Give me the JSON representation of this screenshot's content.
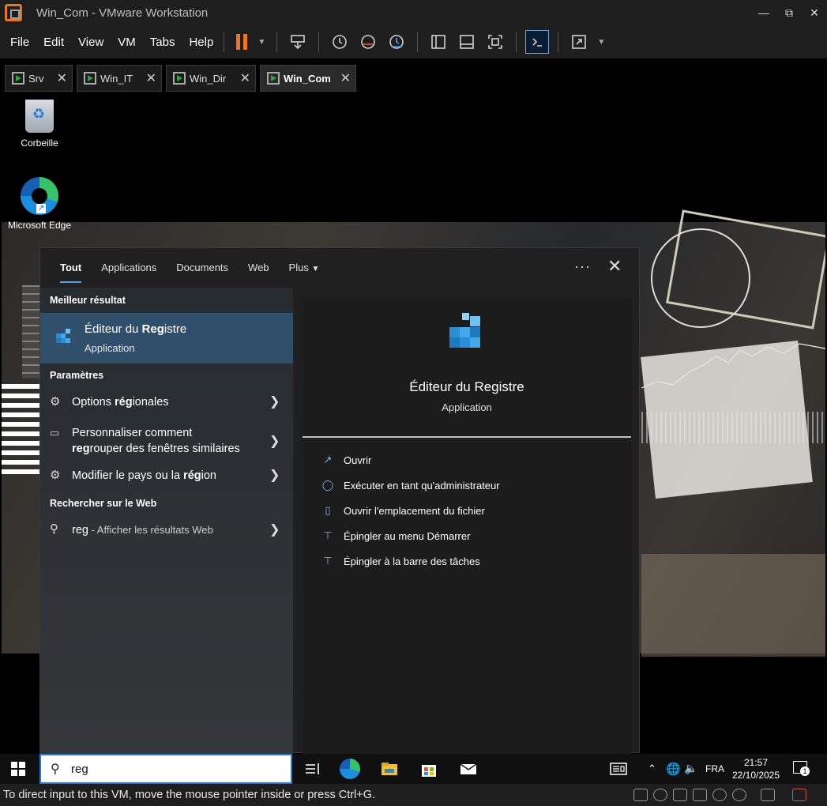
{
  "window": {
    "title": "Win_Com - VMware Workstation",
    "controls": [
      "minimize-icon",
      "restore-icon",
      "close-icon"
    ]
  },
  "menu": [
    "File",
    "Edit",
    "View",
    "VM",
    "Tabs",
    "Help"
  ],
  "tabs": [
    {
      "label": "Srv",
      "active": false
    },
    {
      "label": "Win_IT",
      "active": false
    },
    {
      "label": "Win_Dir",
      "active": false
    },
    {
      "label": "Win_Com",
      "active": true
    }
  ],
  "desktop": {
    "icons": [
      {
        "label": "Corbeille",
        "icon": "recycle-bin-icon"
      },
      {
        "label": "Microsoft Edge",
        "icon": "edge-icon"
      }
    ]
  },
  "search_panel": {
    "filters": [
      "Tout",
      "Applications",
      "Documents",
      "Web",
      "Plus"
    ],
    "active_filter": "Tout",
    "best_section": "Meilleur résultat",
    "best": {
      "name_pre": "Éditeur du ",
      "name_bold": "Reg",
      "name_post": "istre",
      "type": "Application"
    },
    "settings_section": "Paramètres",
    "settings": [
      {
        "pre": "Options ",
        "bold": "rég",
        "post": "ionales",
        "icon": "globe-settings-icon"
      },
      {
        "line1": "Personnaliser comment",
        "bold": "reg",
        "post": "rouper des fenêtres similaires",
        "icon": "taskbar-settings-icon"
      },
      {
        "pre": "Modifier le pays ou la ",
        "bold": "rég",
        "post": "ion",
        "icon": "globe-settings-icon"
      }
    ],
    "web_section": "Rechercher sur le Web",
    "web": {
      "query": "reg",
      "suffix": " - Afficher les résultats Web"
    },
    "detail": {
      "title": "Éditeur du Registre",
      "type": "Application",
      "actions": [
        {
          "label": "Ouvrir",
          "icon": "open-icon"
        },
        {
          "label": "Exécuter en tant qu'administrateur",
          "icon": "shield-icon"
        },
        {
          "label": "Ouvrir l'emplacement du fichier",
          "icon": "file-location-icon"
        },
        {
          "label": "Épingler au menu Démarrer",
          "icon": "pin-icon"
        },
        {
          "label": "Épingler à la barre des tâches",
          "icon": "pin-icon"
        }
      ]
    }
  },
  "taskbar": {
    "search_value": "reg",
    "language": "FRA",
    "time": "21:57",
    "date": "22/10/2025",
    "notification_count": "1"
  },
  "status_bar": {
    "text": "To direct input to this VM, move the mouse pointer inside or press Ctrl+G."
  },
  "colors": {
    "accent": "#4ea2f0",
    "pause": "#f0731f",
    "selected_row": "#2f4f6b"
  }
}
